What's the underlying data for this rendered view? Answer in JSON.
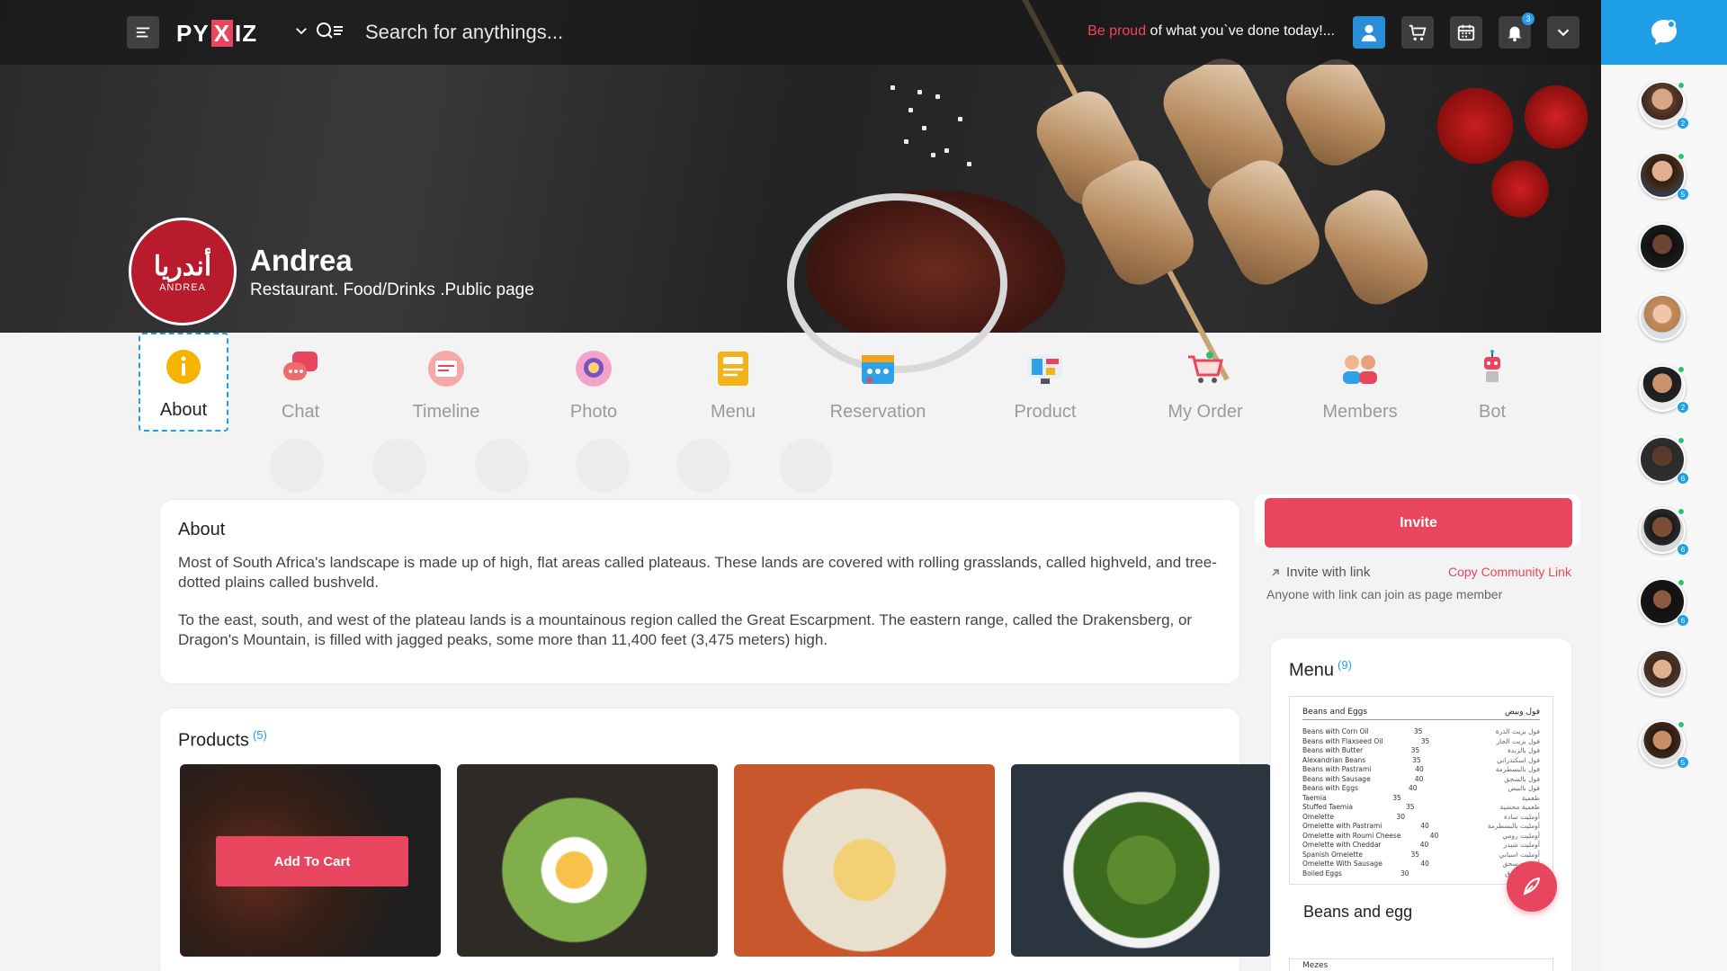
{
  "topbar": {
    "logo_pre": "PY",
    "logo_x": "X",
    "logo_post": "IZ",
    "search_placeholder": "Search for anythings...",
    "motto_accent": "Be proud",
    "motto_rest": " of what you`ve done today!...",
    "notification_count": "3"
  },
  "profile": {
    "logo_ar": "أندريا",
    "logo_en": "ANDREA",
    "name": "Andrea",
    "subtitle": "Restaurant. Food/Drinks .Public page"
  },
  "tabs": [
    {
      "label": "About",
      "icon": "info-icon",
      "active": true
    },
    {
      "label": "Chat",
      "icon": "chat-bubbles-icon"
    },
    {
      "label": "Timeline",
      "icon": "timeline-icon"
    },
    {
      "label": "Photo",
      "icon": "photo-icon"
    },
    {
      "label": "Menu",
      "icon": "menu-book-icon"
    },
    {
      "label": "Reservation",
      "icon": "calendar-icon"
    },
    {
      "label": "Product",
      "icon": "product-icon"
    },
    {
      "label": "My Order",
      "icon": "cart-icon"
    },
    {
      "label": "Members",
      "icon": "members-icon"
    },
    {
      "label": "Bot",
      "icon": "robot-icon"
    }
  ],
  "about": {
    "title": "About",
    "p1": "Most of South Africa's landscape is made up of high, flat areas called plateaus. These lands are covered with rolling grasslands, called highveld, and tree-dotted plains called bushveld.",
    "p2": "To the east, south, and west of the plateau lands is a mountainous region called the Great Escarpment. The eastern range, called the Drakensberg, or Dragon's Mountain, is filled with jagged peaks, some more than 11,400 feet (3,475 meters) high."
  },
  "products": {
    "title": "Products",
    "count": "(5)",
    "add_to_cart": "Add To Cart"
  },
  "invite": {
    "button": "Invite",
    "link_label": "Invite with link",
    "copy_label": "Copy Community Link",
    "note": "Anyone with link can join as page member"
  },
  "menu": {
    "title": "Menu",
    "count": "(9)",
    "sheet_title_en": "Beans and Eggs",
    "sheet_title_ar": "فول وبيض",
    "items": [
      {
        "name": "Beans with Corn Oil",
        "price": "35",
        "ar": "فول بزيت الذرة"
      },
      {
        "name": "Beans with Flaxseed Oil",
        "price": "35",
        "ar": "فول بزيت الحار"
      },
      {
        "name": "Beans with Butter",
        "price": "35",
        "ar": "فول بالزبدة"
      },
      {
        "name": "Alexandrian Beans",
        "price": "35",
        "ar": "فول اسكندراني"
      },
      {
        "name": "Beans with Pastrami",
        "price": "40",
        "ar": "فول بالبسطرمة"
      },
      {
        "name": "Beans with Sausage",
        "price": "40",
        "ar": "فول بالسجق"
      },
      {
        "name": "Beans with Eggs",
        "price": "40",
        "ar": "فول بالبيض"
      },
      {
        "name": "Taemia",
        "price": "35",
        "ar": "طعمية"
      },
      {
        "name": "Stuffed Taemia",
        "price": "35",
        "ar": "طعمية محشية"
      },
      {
        "name": "Omelette",
        "price": "30",
        "ar": "أومليت سادة"
      },
      {
        "name": "Omelette with Pastrami",
        "price": "40",
        "ar": "أومليت بالبسطرمة"
      },
      {
        "name": "Omelette with Roumi Cheese",
        "price": "40",
        "ar": "أومليت رومي"
      },
      {
        "name": "Omelette with Cheddar",
        "price": "40",
        "ar": "أومليت شيدر"
      },
      {
        "name": "Spanish Omelette",
        "price": "35",
        "ar": "أومليت اسباني"
      },
      {
        "name": "Omelette With Sausage",
        "price": "40",
        "ar": "أومليت سجق"
      },
      {
        "name": "Boiled Eggs",
        "price": "30",
        "ar": "بيض مسلوق"
      }
    ],
    "item_title": "Beans and egg",
    "next_sheet": "Mezes"
  },
  "rail": {
    "counts": [
      "2",
      "5",
      "",
      "",
      "2",
      "6",
      "6",
      "6",
      "",
      "5"
    ]
  },
  "colors": {
    "accent": "#e8455e",
    "brand_blue": "#1fa0e6"
  }
}
